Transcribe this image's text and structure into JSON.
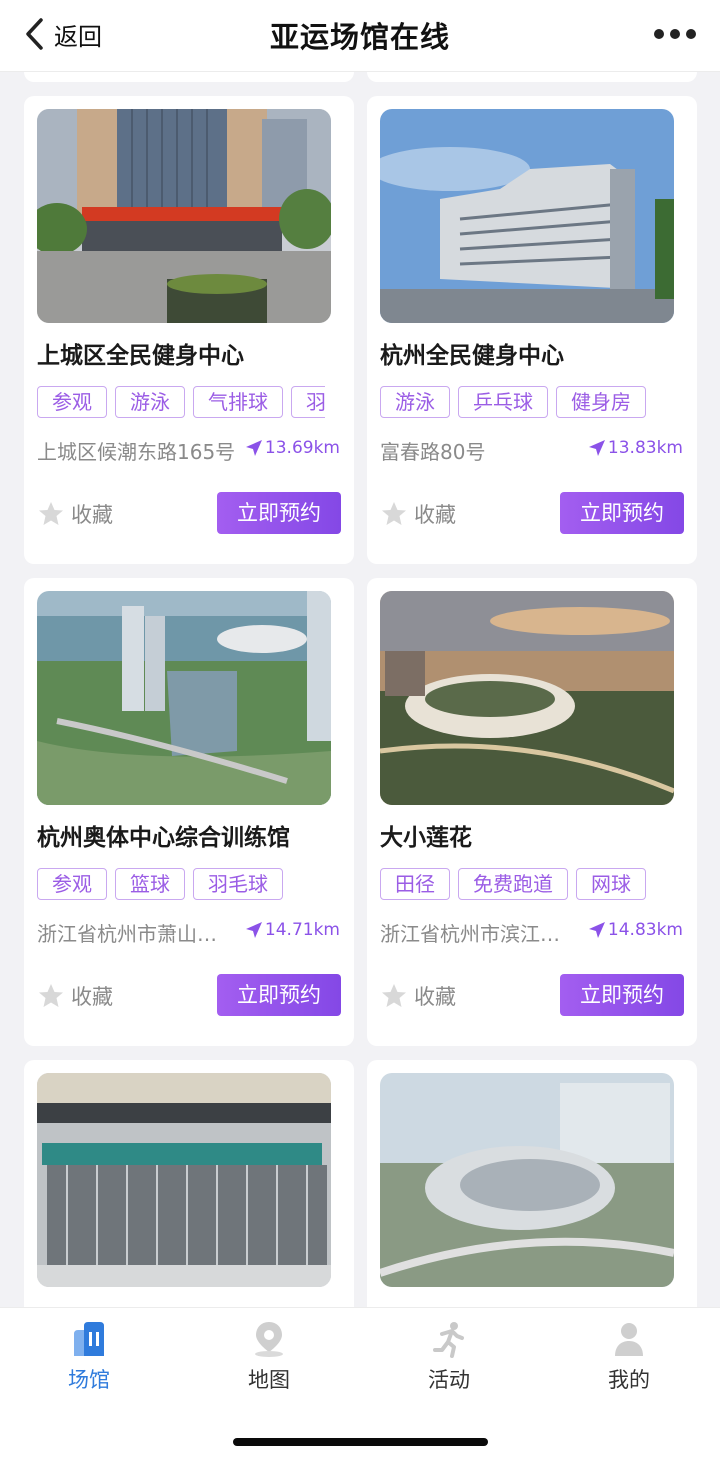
{
  "header": {
    "back_label": "返回",
    "title": "亚运场馆在线"
  },
  "venues": [
    {
      "name": "上城区全民健身中心",
      "tags": [
        "参观",
        "游泳",
        "气排球",
        "羽毛球"
      ],
      "address": "上城区候潮东路165号",
      "distance": "13.69km",
      "favorite_label": "收藏",
      "book_label": "立即预约"
    },
    {
      "name": "杭州全民健身中心",
      "tags": [
        "游泳",
        "乒乓球",
        "健身房"
      ],
      "address": "富春路80号",
      "distance": "13.83km",
      "favorite_label": "收藏",
      "book_label": "立即预约"
    },
    {
      "name": "杭州奥体中心综合训练馆",
      "tags": [
        "参观",
        "篮球",
        "羽毛球"
      ],
      "address": "浙江省杭州市萧山…",
      "distance": "14.71km",
      "favorite_label": "收藏",
      "book_label": "立即预约"
    },
    {
      "name": "大小莲花",
      "tags": [
        "田径",
        "免费跑道",
        "网球"
      ],
      "address": "浙江省杭州市滨江…",
      "distance": "14.83km",
      "favorite_label": "收藏",
      "book_label": "立即预约"
    }
  ],
  "tabbar": [
    {
      "label": "场馆",
      "icon": "building-icon",
      "active": true
    },
    {
      "label": "地图",
      "icon": "map-pin-icon",
      "active": false
    },
    {
      "label": "活动",
      "icon": "runner-icon",
      "active": false
    },
    {
      "label": "我的",
      "icon": "user-icon",
      "active": false
    }
  ],
  "colors": {
    "accent_purple": "#8b52e8",
    "tab_active_blue": "#2f7bdc"
  }
}
